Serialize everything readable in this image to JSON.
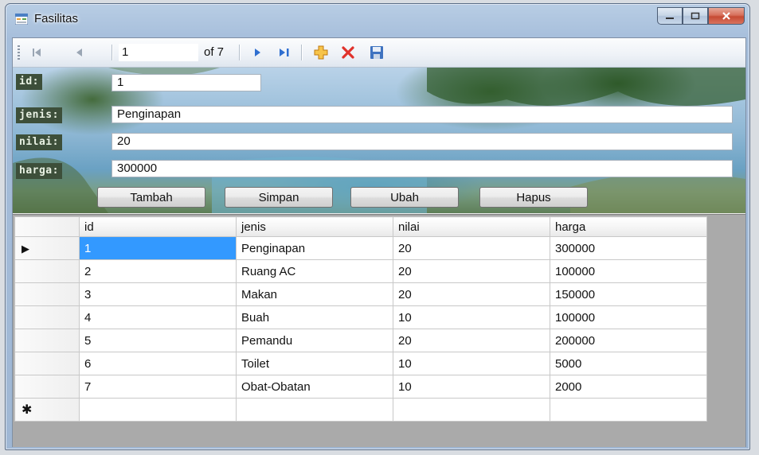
{
  "window": {
    "title": "Fasilitas"
  },
  "navigator": {
    "position": "1",
    "count_label": "of 7"
  },
  "form": {
    "labels": {
      "id": "id:",
      "jenis": "jenis:",
      "nilai": "nilai:",
      "harga": "harga:"
    },
    "values": {
      "id": "1",
      "jenis": "Penginapan",
      "nilai": "20",
      "harga": "300000"
    }
  },
  "buttons": {
    "tambah": "Tambah",
    "simpan": "Simpan",
    "ubah": "Ubah",
    "hapus": "Hapus"
  },
  "grid": {
    "columns": [
      "id",
      "jenis",
      "nilai",
      "harga"
    ],
    "rows": [
      [
        "1",
        "Penginapan",
        "20",
        "300000"
      ],
      [
        "2",
        "Ruang AC",
        "20",
        "100000"
      ],
      [
        "3",
        "Makan",
        "20",
        "150000"
      ],
      [
        "4",
        "Buah",
        "10",
        "100000"
      ],
      [
        "5",
        "Pemandu",
        "20",
        "200000"
      ],
      [
        "6",
        "Toilet",
        "10",
        "5000"
      ],
      [
        "7",
        "Obat-Obatan",
        "10",
        "2000"
      ]
    ],
    "current_row_marker": "▶",
    "new_row_marker": "✱"
  },
  "colors": {
    "selection": "#3399ff",
    "close_button": "#c64a33",
    "grid_background": "#aaaaaa"
  },
  "icons": [
    "app-form-icon",
    "move-first-icon",
    "move-previous-icon",
    "move-next-icon",
    "move-last-icon",
    "add-new-icon",
    "delete-icon",
    "save-icon"
  ]
}
